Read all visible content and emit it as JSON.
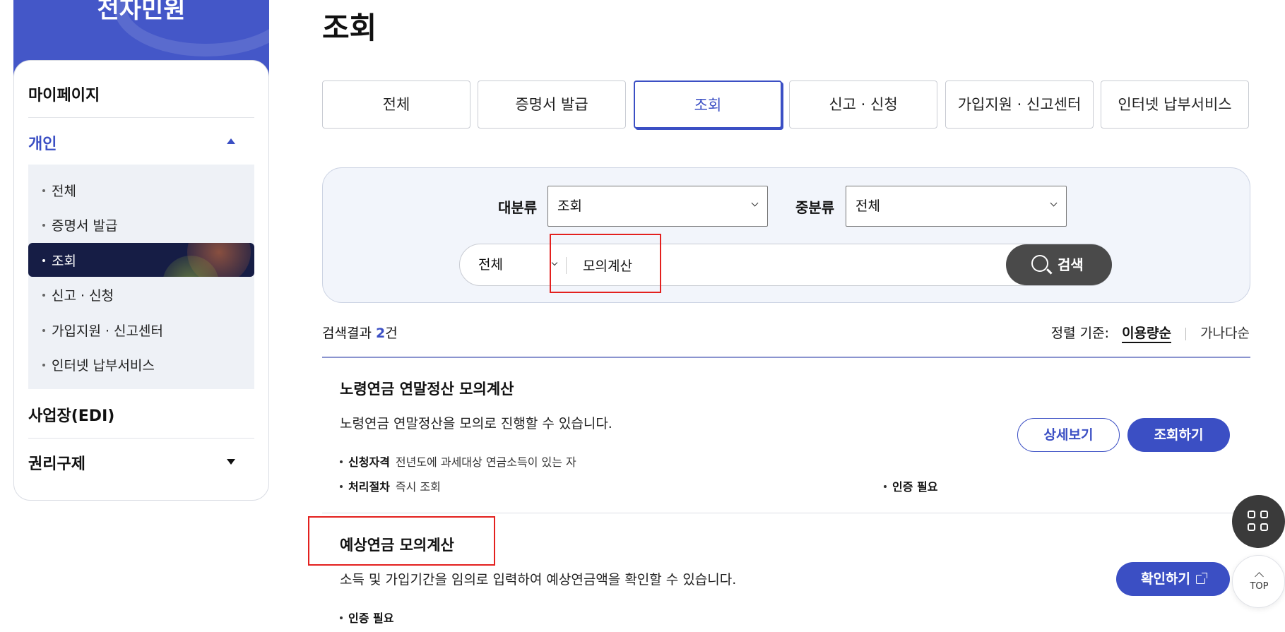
{
  "sidebar": {
    "title": "전자민원",
    "items": [
      {
        "label": "마이페이지"
      },
      {
        "label": "개인"
      },
      {
        "label": "사업장(EDI)"
      },
      {
        "label": "권리구제"
      }
    ],
    "subitems": [
      {
        "label": "전체"
      },
      {
        "label": "증명서 발급"
      },
      {
        "label": "조회"
      },
      {
        "label": "신고 · 신청"
      },
      {
        "label": "가입지원 · 신고센터"
      },
      {
        "label": "인터넷 납부서비스"
      }
    ]
  },
  "main": {
    "title": "조회",
    "tabs": [
      {
        "label": "전체"
      },
      {
        "label": "증명서 발급"
      },
      {
        "label": "조회"
      },
      {
        "label": "신고 · 신청"
      },
      {
        "label": "가입지원 · 신고센터"
      },
      {
        "label": "인터넷 납부서비스"
      }
    ],
    "active_tab": "조회"
  },
  "filters": {
    "major_label": "대분류",
    "major_value": "조회",
    "middle_label": "중분류",
    "middle_value": "전체",
    "scope_value": "전체",
    "query": "모의계산",
    "search_button": "검색"
  },
  "results": {
    "count_prefix": "검색결과 ",
    "count": "2",
    "count_suffix": "건",
    "sort_label": "정렬 기준:",
    "sort_active": "이용량순",
    "sort_other": "가나다순",
    "items": [
      {
        "title": "노령연금 연말정산 모의계산",
        "desc": "노령연금 연말정산을 모의로 진행할 수 있습니다.",
        "eligibility_label": "신청자격",
        "eligibility": "전년도에 과세대상 연금소득이 있는 자",
        "process_label": "처리절차",
        "process": "즉시 조회",
        "auth": "인증 필요",
        "detail_button": "상세보기",
        "action_button": "조회하기"
      },
      {
        "title": "예상연금 모의계산",
        "desc": "소득 및 가입기간을 임의로 입력하여 예상연금액을 확인할 수 있습니다.",
        "auth": "인증 필요",
        "action_button": "확인하기"
      }
    ]
  },
  "fab": {
    "top_label": "TOP"
  },
  "colors": {
    "accent": "#3b4fc4",
    "sidebar_header": "#4457c8",
    "active_sub_bg": "#161d45",
    "highlight_box": "#e3201e"
  }
}
